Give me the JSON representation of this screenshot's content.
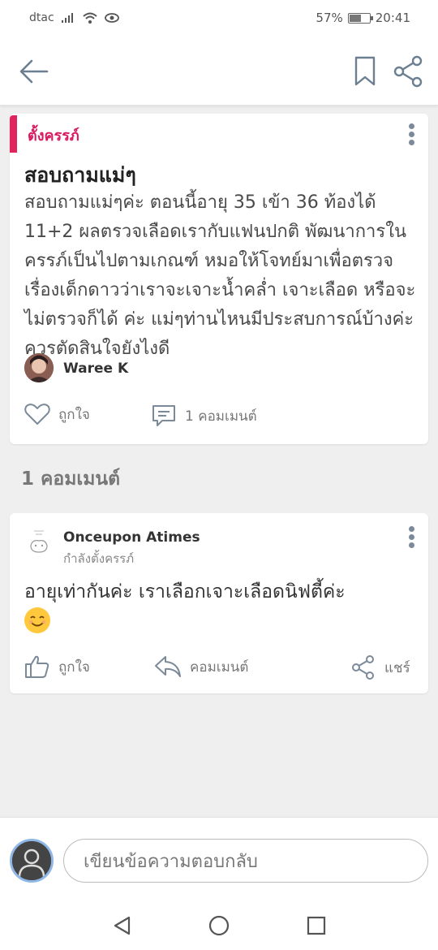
{
  "status_bar": {
    "carrier": "dtac",
    "battery": "57%",
    "time": "20:41"
  },
  "header": {
    "back_icon": "arrow-left-icon",
    "bookmark_icon": "bookmark-icon",
    "share_icon": "share-icon"
  },
  "post": {
    "tag": "ตั้งครรภ์",
    "title": "สอบถามแม่ๆ",
    "body": "สอบถามแม่ๆค่ะ ตอนนี้อายุ 35 เข้า 36 ท้องได้ 11+2 ผลตรวจเลือดเรากับแฟนปกติ พัฒนาการในครรภ์เป็นไปตามเกณฑ์ หมอให้โจทย์มาเพื่อตรวจเรื่องเด็กดาวว่าเราจะเจาะน้ำคล่ำ เจาะเลือด หรือจะไม่ตรวจก็ได้ ค่ะ แม่ๆท่านไหนมีประสบการณ์บ้างค่ะ ควรตัดสินใจยังไงดี",
    "author": "Waree K",
    "like_label": "ถูกใจ",
    "comment_count_label": "1 คอมเมนต์"
  },
  "comments_section": {
    "title": "1 คอมเมนต์"
  },
  "comment": {
    "author": "Onceupon Atimes",
    "status": "กำลังตั้งครรภ์",
    "text": "อายุเท่ากันค่ะ เราเลือกเจาะเลือดนิฟตี้ค่ะ",
    "like_label": "ถูกใจ",
    "reply_label": "คอมเมนต์",
    "share_label": "แชร์"
  },
  "reply_bar": {
    "placeholder": "เขียนข้อความตอบกลับ"
  },
  "colors": {
    "accent": "#e0245e",
    "background": "#efefef"
  }
}
